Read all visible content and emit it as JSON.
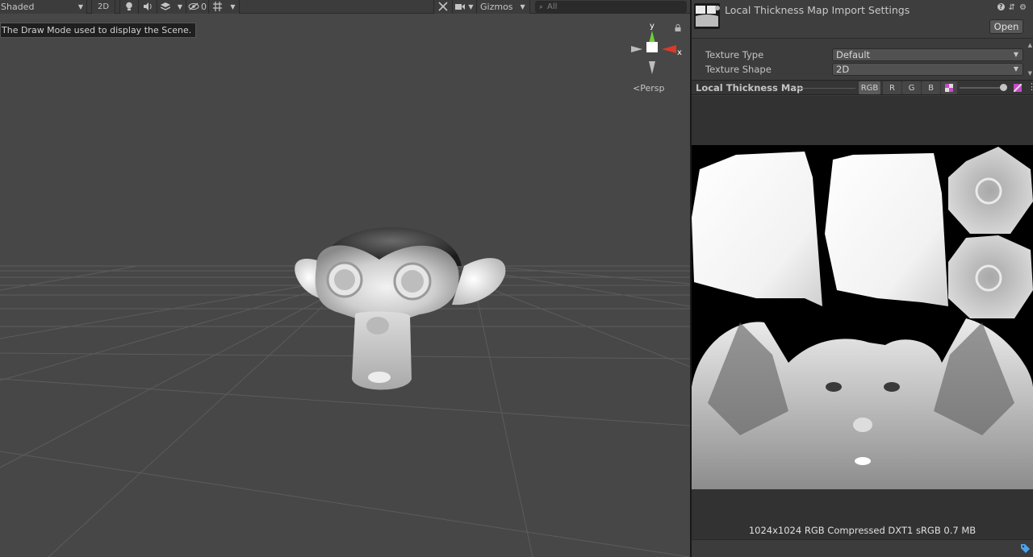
{
  "scene": {
    "toolbar": {
      "draw_mode": "Shaded",
      "mode_2d": "2D",
      "hidden_count": "0",
      "gizmos_label": "Gizmos",
      "search_placeholder": "All"
    },
    "tooltip": "The Draw Mode used to display the Scene.",
    "gizmo": {
      "x_label": "x",
      "y_label": "y",
      "projection": "Persp"
    }
  },
  "inspector": {
    "title": "Local Thickness Map Import Settings",
    "open_label": "Open",
    "fields": [
      {
        "label": "Texture Type",
        "value": "Default"
      },
      {
        "label": "Texture Shape",
        "value": "2D"
      }
    ],
    "preview": {
      "title": "Local Thickness Map",
      "channels": [
        "RGB",
        "R",
        "G",
        "B"
      ],
      "mip_level": 1.0,
      "info": "1024x1024  RGB Compressed DXT1 sRGB   0.7 MB"
    }
  },
  "colors": {
    "scene_bg": "#474747",
    "panel_bg": "#3c3c3c",
    "axis_x": "#d83b2a",
    "axis_y": "#6cd13a"
  }
}
